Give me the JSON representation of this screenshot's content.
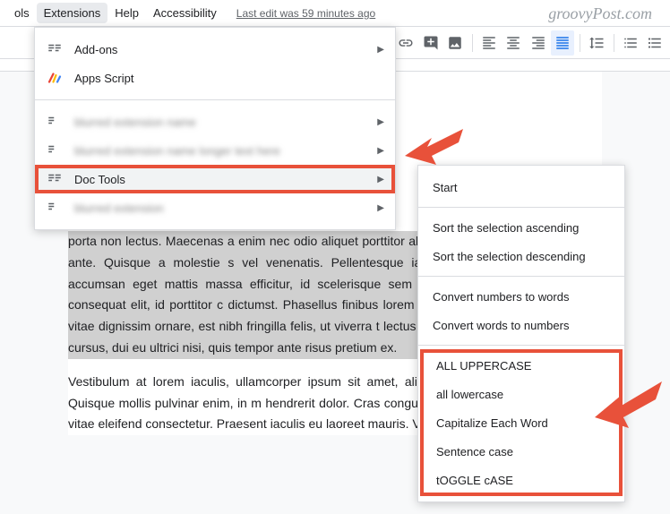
{
  "menubar": {
    "tools": "ols",
    "extensions": "Extensions",
    "help": "Help",
    "accessibility": "Accessibility",
    "last_edit": "Last edit was 59 minutes ago"
  },
  "watermark": "groovyPost.com",
  "dropdown": {
    "addons": "Add-ons",
    "apps_script": "Apps Script",
    "blur1": "blurred extension name",
    "blur2": "blurred extension name longer text here",
    "doc_tools": "Doc Tools",
    "blur3": "blurred extension"
  },
  "submenu": {
    "start": "Start",
    "sort_asc": "Sort the selection ascending",
    "sort_desc": "Sort the selection descending",
    "num_to_words": "Convert numbers to words",
    "words_to_num": "Convert words to numbers",
    "uppercase": "ALL UPPERCASE",
    "lowercase": "all lowercase",
    "capitalize": "Capitalize Each Word",
    "sentence": "Sentence case",
    "toggle": "tOGGLE cASE"
  },
  "document": {
    "selected": "porta non lectus. Maecenas a enim nec odio aliquet porttitor aliquet vitae cursus id, blandit quis ante. Quisque a molestie s vel venenatis. Pellentesque iaculis aliquam felis, eu condim accumsan eget mattis massa efficitur, id scelerisque sem tellus a ullamcorper. Etiam vel consequat elit, id porttitor c dictumst. Phasellus finibus lorem et enim rhoncus, at viverra urna vitae dignissim ornare, est nibh fringilla felis, ut viverra t lectus eget condimentum rhoncus. Sed cursus, dui eu ultrici nisi, quis tempor ante risus pretium ex.",
    "normal": "Vestibulum at lorem iaculis, ullamcorper ipsum sit amet, aliqu vitae ultrices leo semper in. Quisque mollis pulvinar enim, in m hendrerit dolor. Cras congue ante nunc, nec viverra vulputat vitae eleifend consectetur. Praesent iaculis eu laoreet mauris. Ves"
  }
}
